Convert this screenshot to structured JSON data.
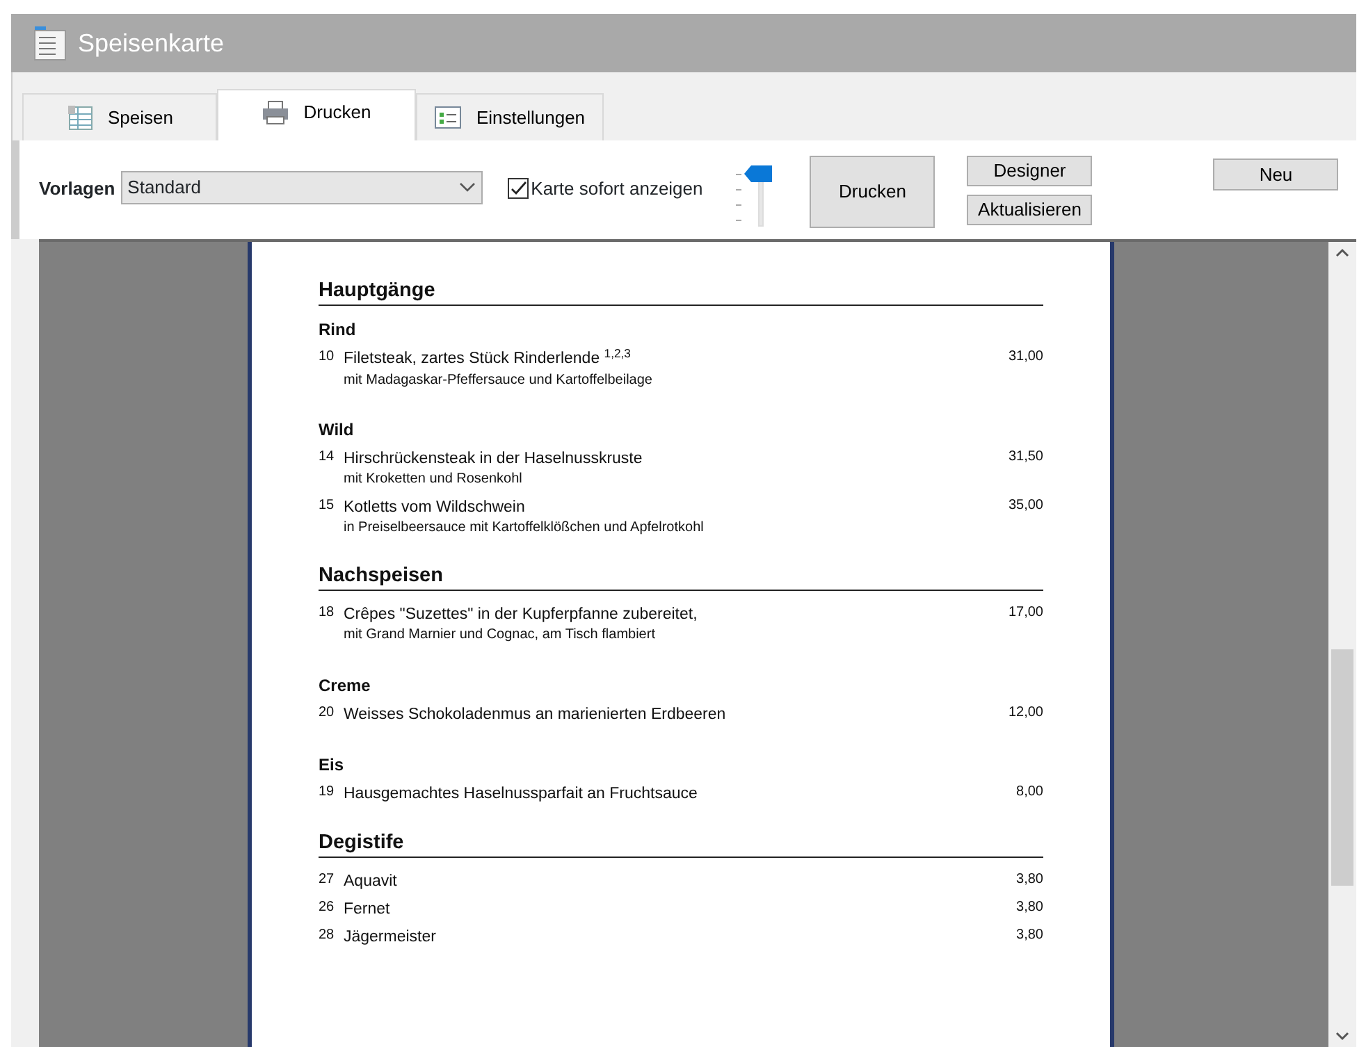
{
  "window": {
    "title": "Speisenkarte"
  },
  "tabs": [
    {
      "label": "Speisen",
      "selected": false
    },
    {
      "label": "Drucken",
      "selected": true
    },
    {
      "label": "Einstellungen",
      "selected": false
    }
  ],
  "toolbar": {
    "template_label": "Vorlagen",
    "template_value": "Standard",
    "show_card": {
      "label": "Karte sofort anzeigen",
      "checked": true
    },
    "print_button": "Drucken",
    "designer_button": "Designer",
    "refresh_button": "Aktualisieren",
    "new_button": "Neu"
  },
  "preview": {
    "sections": [
      {
        "heading": "Hauptgänge",
        "entries": [
          {
            "kind": "subheading",
            "text": "Rind"
          },
          {
            "kind": "item",
            "number": "10",
            "name": "Filetsteak, zartes Stück Rinderlende $^{1,2,3}$",
            "description": "mit Madagaskar-Pfeffersauce und Kartoffelbeilage",
            "price": "31,00"
          },
          {
            "kind": "subheading",
            "text": "Wild"
          },
          {
            "kind": "item",
            "number": "14",
            "name": "Hirschrückensteak in der Haselnusskruste",
            "description": "mit Kroketten und Rosenkohl",
            "price": "31,50"
          },
          {
            "kind": "item",
            "number": "15",
            "name": "Kotletts vom Wildschwein",
            "description": "in Preiselbeersauce mit Kartoffelklößchen und Apfelrotkohl",
            "price": "35,00"
          }
        ]
      },
      {
        "heading": "Nachspeisen",
        "entries": [
          {
            "kind": "item",
            "number": "18",
            "name": "Crêpes \"Suzettes\" in der Kupferpfanne zubereitet,",
            "description": "mit Grand Marnier und Cognac, am Tisch flambiert",
            "price": "17,00"
          },
          {
            "kind": "subheading",
            "text": "Creme"
          },
          {
            "kind": "item",
            "number": "20",
            "name": "Weisses Schokoladenmus an marienierten Erdbeeren",
            "price": "12,00"
          },
          {
            "kind": "subheading",
            "text": "Eis"
          },
          {
            "kind": "item",
            "number": "19",
            "name": "Hausgemachtes Haselnussparfait an Fruchtsauce",
            "price": "8,00"
          }
        ]
      },
      {
        "heading": "Degistife",
        "entries": [
          {
            "kind": "item",
            "number": "27",
            "name": "Aquavit",
            "price": "3,80"
          },
          {
            "kind": "item",
            "number": "26",
            "name": "Fernet",
            "price": "3,80"
          },
          {
            "kind": "item",
            "number": "28",
            "name": "Jägermeister",
            "price": "3,80"
          }
        ]
      }
    ]
  }
}
